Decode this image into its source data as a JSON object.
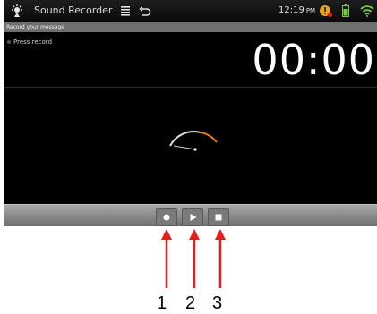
{
  "status_bar": {
    "app_title": "Sound Recorder",
    "time": "12:19",
    "ampm": "PM",
    "icons": [
      "app-icon",
      "menu-icon",
      "back-icon",
      "alert-icon",
      "battery-icon",
      "wifi-icon"
    ]
  },
  "subheader": {
    "text": "Record your message"
  },
  "main": {
    "state_label": "Press record",
    "timer": "00:00"
  },
  "controls": {
    "buttons": [
      {
        "name": "record",
        "icon": "record-icon"
      },
      {
        "name": "play",
        "icon": "play-icon"
      },
      {
        "name": "stop",
        "icon": "stop-icon"
      }
    ]
  },
  "annotations": {
    "labels": [
      "1",
      "2",
      "3"
    ],
    "arrow_color": "#e41e1e"
  },
  "colors": {
    "screen_bg": "#000000",
    "vu_needle_accent": "#e8761e"
  }
}
